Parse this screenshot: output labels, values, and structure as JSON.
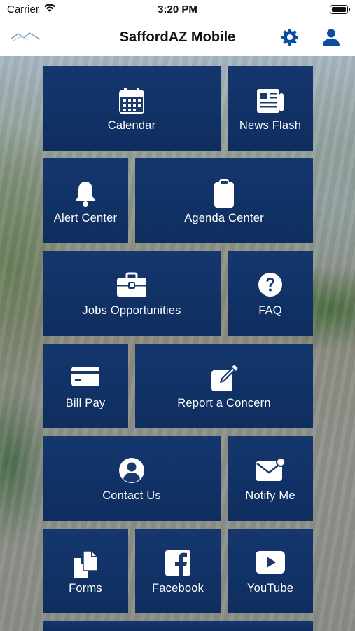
{
  "status": {
    "carrier": "Carrier",
    "time": "3:20 PM"
  },
  "nav": {
    "title": "SaffordAZ Mobile"
  },
  "tiles": {
    "calendar": "Calendar",
    "news_flash": "News Flash",
    "alert_center": "Alert Center",
    "agenda_center": "Agenda Center",
    "jobs": "Jobs Opportunities",
    "faq": "FAQ",
    "bill_pay": "Bill Pay",
    "report_concern": "Report a Concern",
    "contact_us": "Contact Us",
    "notify_me": "Notify Me",
    "forms": "Forms",
    "facebook": "Facebook",
    "youtube": "YouTube"
  },
  "colors": {
    "tile": "#1a3a6b",
    "nav_icon": "#0c4da2"
  }
}
